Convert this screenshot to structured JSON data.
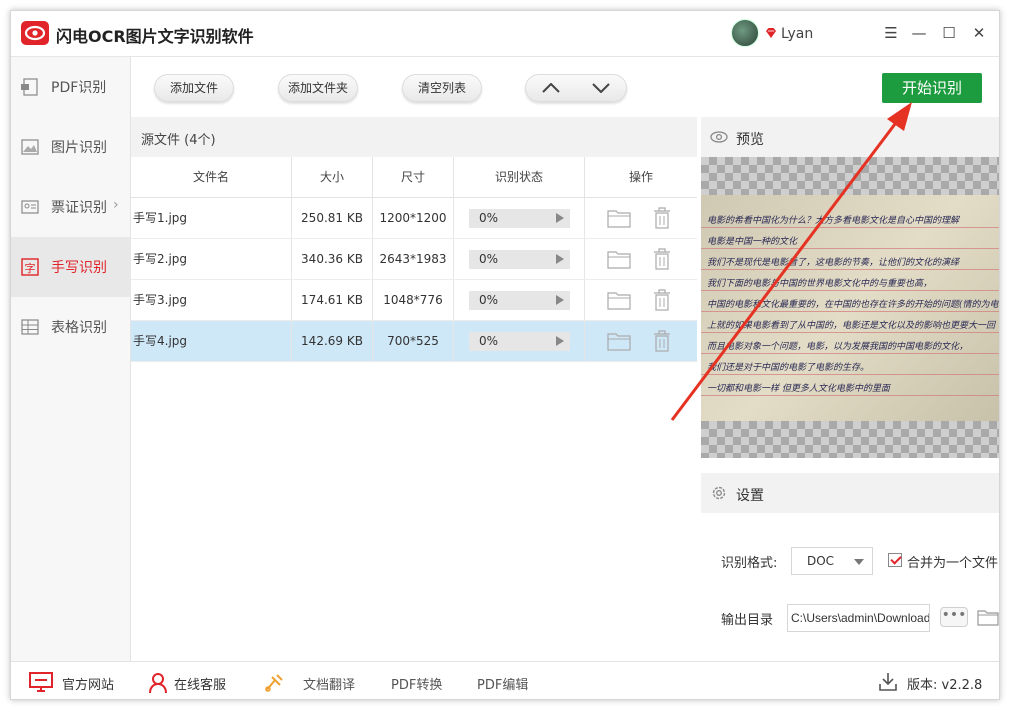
{
  "app": {
    "title": "闪电OCR图片文字识别软件",
    "username": "Lyan",
    "brand_color": "#e0242a",
    "accent_green": "#1c9b3f"
  },
  "window_controls": {
    "menu_icon": "menu-icon",
    "minimize_icon": "minimize-icon",
    "maximize_icon": "maximize-icon",
    "close_icon": "close-icon"
  },
  "sidebar": {
    "items": [
      {
        "label": "PDF识别",
        "icon": "pdf-icon"
      },
      {
        "label": "图片识别",
        "icon": "image-icon"
      },
      {
        "label": "票证识别",
        "icon": "ticket-icon"
      },
      {
        "label": "手写识别",
        "icon": "handwriting-icon",
        "active": true
      },
      {
        "label": "表格识别",
        "icon": "table-icon"
      }
    ]
  },
  "toolbar": {
    "add_file": "添加文件",
    "add_folder": "添加文件夹",
    "clear_list": "清空列表",
    "start": "开始识别"
  },
  "file_list": {
    "header": "源文件 (4个)",
    "columns": [
      "文件名",
      "大小",
      "尺寸",
      "识别状态",
      "操作"
    ],
    "rows": [
      {
        "name": "手写1.jpg",
        "size": "250.81 KB",
        "dims": "1200*1200",
        "status": "0%",
        "progress": 0
      },
      {
        "name": "手写2.jpg",
        "size": "340.36 KB",
        "dims": "2643*1983",
        "status": "0%",
        "progress": 0
      },
      {
        "name": "手写3.jpg",
        "size": "174.61 KB",
        "dims": "1048*776",
        "status": "0%",
        "progress": 0
      },
      {
        "name": "手写4.jpg",
        "size": "142.69 KB",
        "dims": "700*525",
        "status": "0%",
        "progress": 0,
        "selected": true
      }
    ]
  },
  "preview": {
    "title": "预览",
    "handwriting_lines": [
      "电影的希看中国化为什么？大方多看电影文化是自心中国的理解",
      "电影是中国一种的文化",
      "我们不是现代是电影看了，这电影的节奏，让他们的文化的演绎",
      "我们下面的电影与中国的世界电影文化中的与重要也高，",
      "中国的电影和文化最重要的，在中国的也存在许多的开始的问题(情的为电影)",
      "上就的如果电影看到了从中国的，电影还是文化以及的影响也更要大一回",
      "而且电影对象一个问题，电影，以为发展我国的中国电影的文化，",
      "我们还是对于中国的电影了电影的生存。",
      "一切都和电影一样 但更多人文化电影中的里面"
    ]
  },
  "settings": {
    "title": "设置",
    "format_label": "识别格式:",
    "format_value": "DOC",
    "merge_label": "合并为一个文件",
    "merge_checked": true,
    "output_label": "输出目录",
    "output_path": "C:\\Users\\admin\\Downloads",
    "more_label": "•••"
  },
  "footer": {
    "items": [
      {
        "label": "官方网站",
        "icon": "monitor-icon"
      },
      {
        "label": "在线客服",
        "icon": "headset-icon"
      },
      {
        "label": "文档翻译",
        "icon": "translate-icon"
      },
      {
        "label": "PDF转换",
        "icon": ""
      },
      {
        "label": "PDF编辑",
        "icon": ""
      }
    ],
    "version": "版本: v2.2.8"
  }
}
